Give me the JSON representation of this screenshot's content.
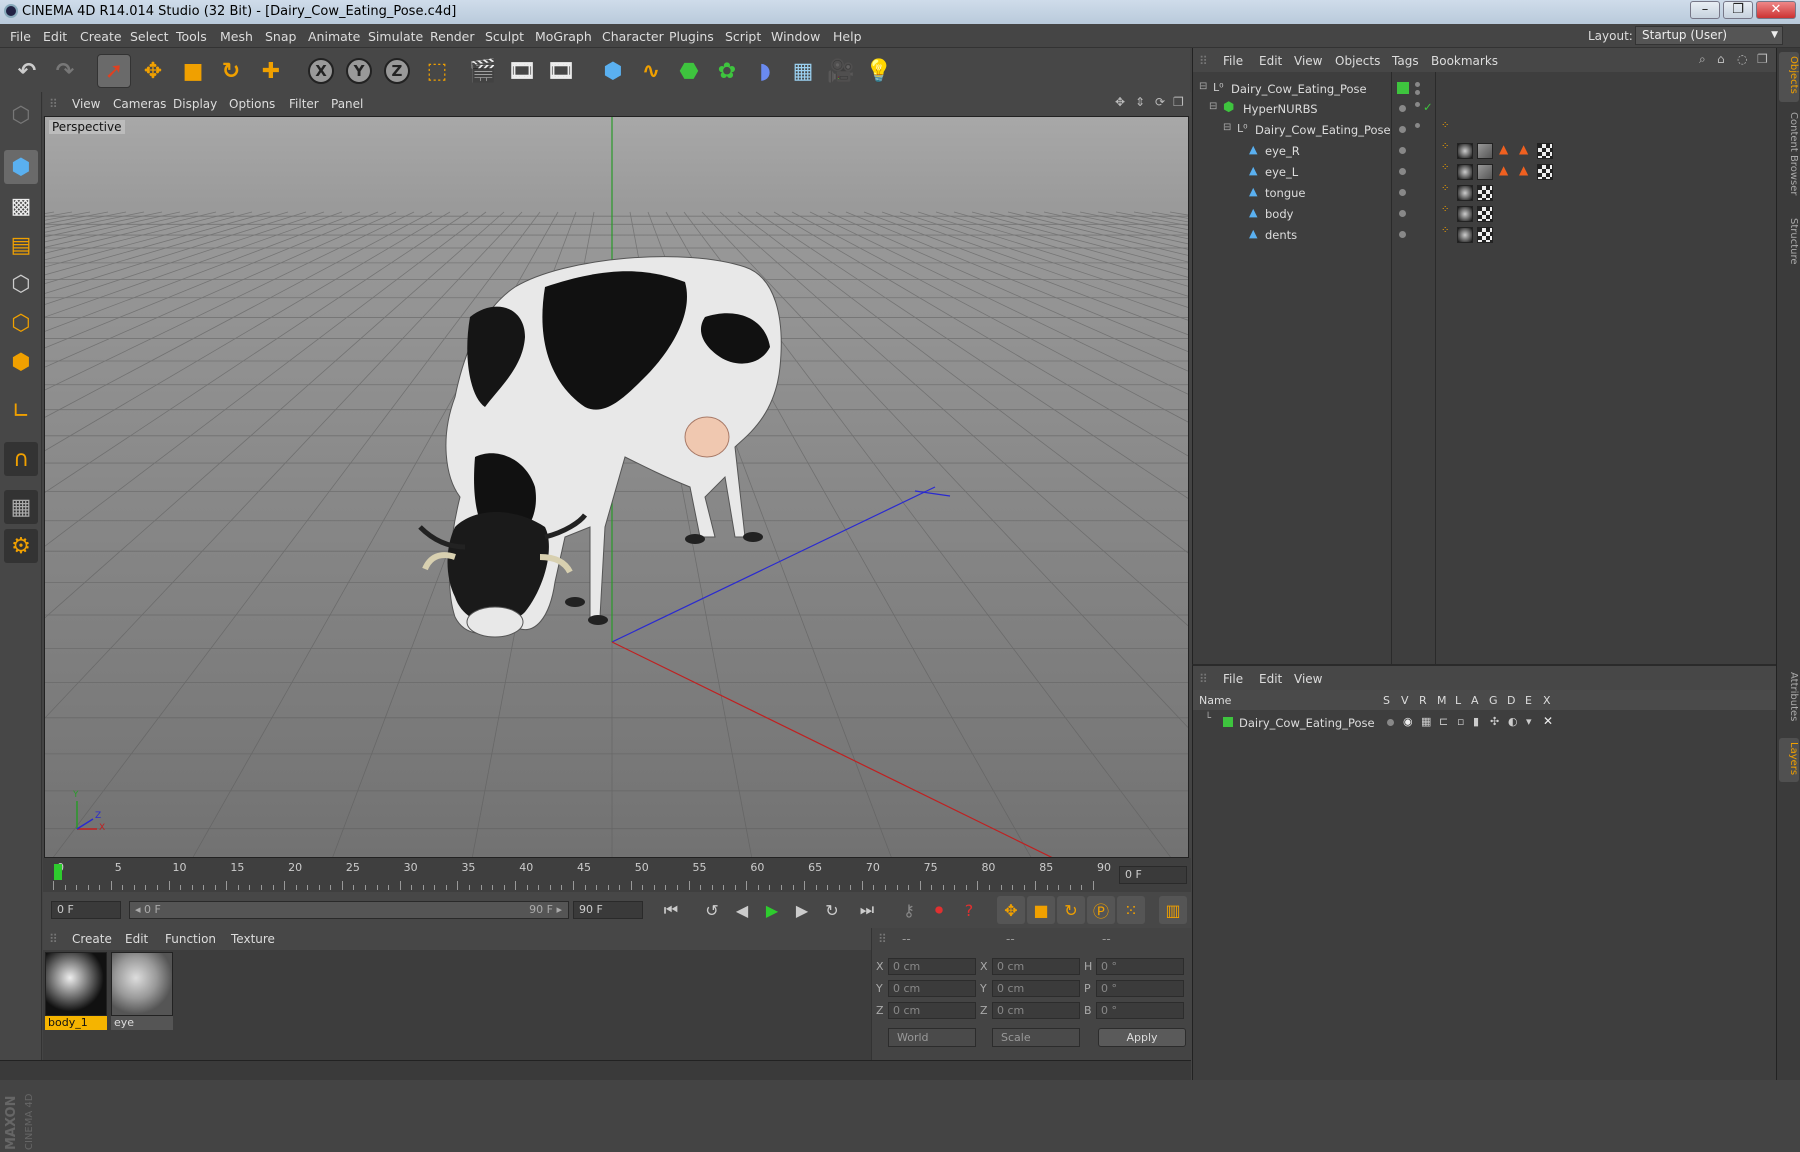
{
  "window": {
    "title": "CINEMA 4D R14.014 Studio (32 Bit) - [Dairy_Cow_Eating_Pose.c4d]",
    "buttons": [
      "–",
      "❐",
      "✕"
    ]
  },
  "menubar": {
    "items": [
      "File",
      "Edit",
      "Create",
      "Select",
      "Tools",
      "Mesh",
      "Snap",
      "Animate",
      "Simulate",
      "Render",
      "Sculpt",
      "MoGraph",
      "Character",
      "Plugins",
      "Script",
      "Window",
      "Help"
    ],
    "layout_label": "Layout:",
    "layout_value": "Startup (User)"
  },
  "viewport": {
    "menu": [
      "View",
      "Cameras",
      "Display",
      "Options",
      "Filter",
      "Panel"
    ],
    "label": "Perspective",
    "axis_labels": {
      "y": "Y",
      "x": "X",
      "z": "Z"
    }
  },
  "timeline": {
    "ticks": [
      "0",
      "5",
      "10",
      "15",
      "20",
      "25",
      "30",
      "35",
      "40",
      "45",
      "50",
      "55",
      "60",
      "65",
      "70",
      "75",
      "80",
      "85",
      "90"
    ],
    "current_frame": "0 F"
  },
  "playbar": {
    "start_field": "0 F",
    "range_start": "◂ 0 F",
    "range_end": "90 F ▸",
    "end_field": "90 F"
  },
  "materials": {
    "menu": [
      "Create",
      "Edit",
      "Function",
      "Texture"
    ],
    "items": [
      {
        "name": "body_1",
        "selected": true
      },
      {
        "name": "eye",
        "selected": false
      }
    ]
  },
  "coordinates": {
    "headers": [
      "--",
      "--",
      "--"
    ],
    "rows": [
      {
        "a": "X",
        "av": "0 cm",
        "b": "X",
        "bv": "0 cm",
        "c": "H",
        "cv": "0 °"
      },
      {
        "a": "Y",
        "av": "0 cm",
        "b": "Y",
        "bv": "0 cm",
        "c": "P",
        "cv": "0 °"
      },
      {
        "a": "Z",
        "av": "0 cm",
        "b": "Z",
        "bv": "0 cm",
        "c": "B",
        "cv": "0 °"
      }
    ],
    "mode": "World",
    "type": "Scale",
    "apply": "Apply"
  },
  "object_manager": {
    "menu": [
      "File",
      "Edit",
      "View",
      "Objects",
      "Tags",
      "Bookmarks"
    ],
    "objects": [
      {
        "name": "Dairy_Cow_Eating_Pose",
        "depth": 0
      },
      {
        "name": "HyperNURBS",
        "depth": 1
      },
      {
        "name": "Dairy_Cow_Eating_Pose",
        "depth": 2
      },
      {
        "name": "eye_R",
        "depth": 3
      },
      {
        "name": "eye_L",
        "depth": 3
      },
      {
        "name": "tongue",
        "depth": 3
      },
      {
        "name": "body",
        "depth": 3
      },
      {
        "name": "dents",
        "depth": 3
      }
    ]
  },
  "layer_manager": {
    "menu": [
      "File",
      "Edit",
      "View"
    ],
    "columns": [
      "Name",
      "S",
      "V",
      "R",
      "M",
      "L",
      "A",
      "G",
      "D",
      "E",
      "X"
    ],
    "layers": [
      {
        "name": "Dairy_Cow_Eating_Pose",
        "color": "#3ec43e"
      }
    ]
  },
  "side_tabs": [
    "Objects",
    "Content Browser",
    "Structure",
    "Attributes",
    "Layers"
  ],
  "brand": "MAXON CINEMA 4D",
  "colors": {
    "accent": "#f0a000",
    "selection": "#f5b400",
    "play": "#2ecc2e"
  }
}
